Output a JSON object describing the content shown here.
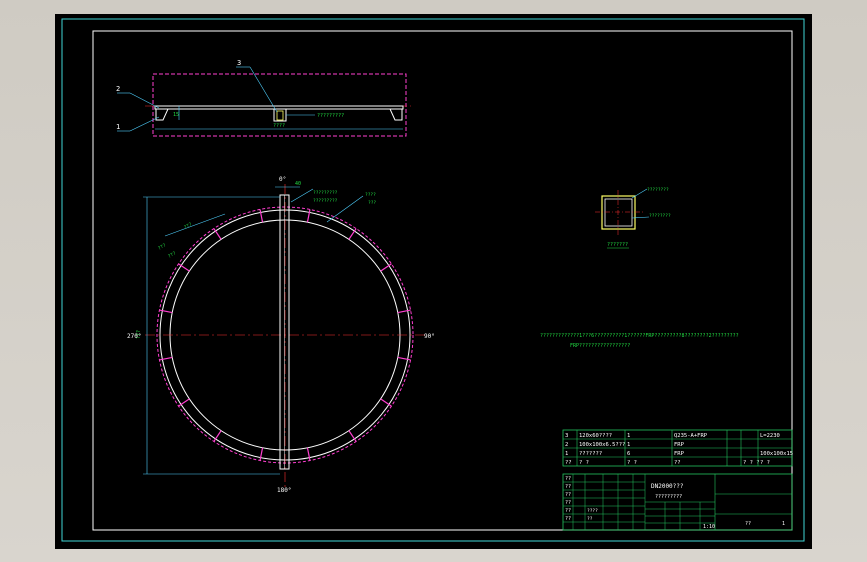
{
  "colors": {
    "background": "#000000",
    "frame": "#d4d0c8",
    "border_outer": "#3fd6d6",
    "border_inner": "#ffffff",
    "table": "#22c55e",
    "dimension": "#4fd1ff",
    "hidden": "#ff3fd0",
    "centerline": "#ff3030",
    "part": "#ffffff",
    "label": "#22dd44",
    "highlight": "#ffff66"
  },
  "top_view": {
    "callouts": [
      "2",
      "1",
      "3"
    ],
    "label_3": "?????????",
    "dim_height": "15",
    "dim_width": "????"
  },
  "ring_view": {
    "angle_top": "0°",
    "angle_right": "90°",
    "angle_bottom": "180°",
    "angle_left": "270°",
    "dim_top": "40",
    "dim_left": "???",
    "note_1": "?????????",
    "note_2": "?????????",
    "note_3": "????",
    "note_4": "???",
    "note_5": "???",
    "note_6": "???",
    "note_7": "???"
  },
  "detail_view": {
    "label_1": "????????",
    "label_2": "????????",
    "caption": "???????"
  },
  "notes": {
    "line1": "?????????????1???6??????????1??????FRP?????????8????????2?????????",
    "line2": "FRP?????????????????"
  },
  "bom": {
    "rows": [
      [
        "3",
        "120x60????",
        "1",
        "Q235-A+FRP",
        "",
        "",
        "L=2230"
      ],
      [
        "2",
        "100x100x6.5???",
        "1",
        "FRP",
        "",
        "",
        ""
      ],
      [
        "1",
        "???????",
        "6",
        "FRP",
        "",
        "",
        "100x100x15"
      ],
      [
        "??",
        "? ?",
        "? ?",
        "??",
        "",
        "? ? ?",
        "? ?"
      ]
    ]
  },
  "title_block": {
    "drawing_name": "DN2000???",
    "subtitle": "?????????",
    "scale": "1:10",
    "sheet": "??",
    "sheet_count": "1",
    "row_labels": [
      "??",
      "??",
      "??",
      "??",
      "??",
      "??"
    ],
    "rev_cells": [
      "????",
      "??",
      "??",
      "??",
      "??",
      "??"
    ]
  }
}
